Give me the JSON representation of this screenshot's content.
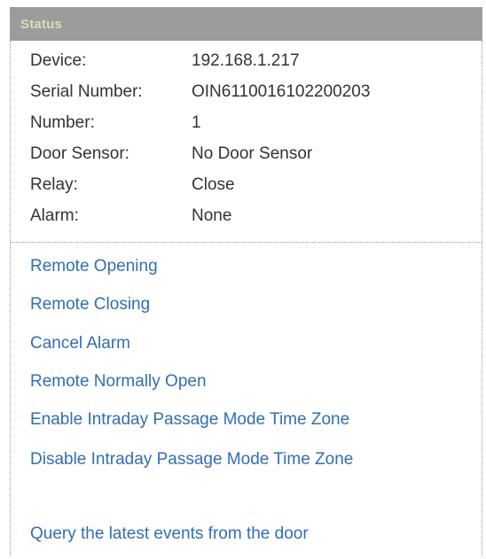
{
  "panel": {
    "title": "Status"
  },
  "info": [
    {
      "key": "Device:",
      "value": "192.168.1.217"
    },
    {
      "key": "Serial Number:",
      "value": "OIN6110016102200203"
    },
    {
      "key": "Number:",
      "value": "1"
    },
    {
      "key": "Door Sensor:",
      "value": "No Door Sensor"
    },
    {
      "key": "Relay:",
      "value": "Close"
    },
    {
      "key": "Alarm:",
      "value": "None"
    }
  ],
  "actions": [
    "Remote Opening",
    "Remote Closing",
    "Cancel Alarm",
    "Remote Normally Open",
    "Enable Intraday Passage Mode Time Zone",
    "Disable Intraday Passage Mode Time Zone",
    "Query the latest events from the door"
  ],
  "colors": {
    "header_bg": "#9c9c9c",
    "header_text": "#cfe1b8",
    "link": "#2f6fb5",
    "text": "#333333"
  }
}
